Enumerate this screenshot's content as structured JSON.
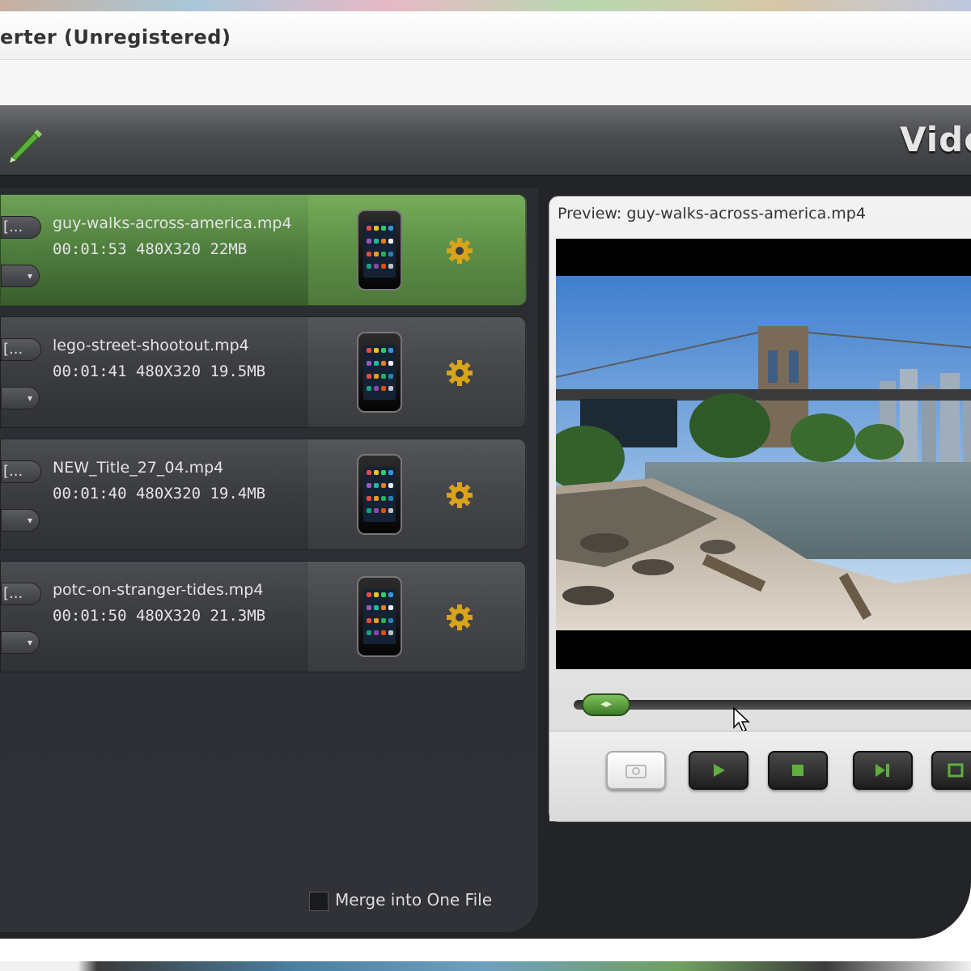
{
  "window": {
    "title": "erter (Unregistered)"
  },
  "toolbar": {
    "title": "Vide",
    "edit_icon": "pencil-icon"
  },
  "files": [
    {
      "name": "guy-walks-across-america.mp4",
      "meta": "00:01:53  480X320  22MB",
      "pill": "[...",
      "selected": true
    },
    {
      "name": "lego-street-shootout.mp4",
      "meta": "00:01:41  480X320  19.5MB",
      "pill": "[...",
      "selected": false
    },
    {
      "name": "NEW_Title_27_04.mp4",
      "meta": "00:01:40  480X320  19.4MB",
      "pill": "[...",
      "selected": false
    },
    {
      "name": "potc-on-stranger-tides.mp4",
      "meta": "00:01:50  480X320  21.3MB",
      "pill": "[...",
      "selected": false
    }
  ],
  "merge": {
    "label": "Merge into One File",
    "checked": false
  },
  "preview": {
    "title": "Preview: guy-walks-across-america.mp4",
    "progress": 0.02
  },
  "controls": [
    {
      "name": "snapshot-button",
      "icon": "camera-icon",
      "disabled": true
    },
    {
      "name": "play-button",
      "icon": "play-icon",
      "disabled": false
    },
    {
      "name": "stop-button",
      "icon": "stop-icon",
      "disabled": false
    },
    {
      "name": "next-button",
      "icon": "next-icon",
      "disabled": false
    },
    {
      "name": "fullscreen-button",
      "icon": "fullscreen-icon",
      "disabled": false
    }
  ],
  "colors": {
    "accent_green": "#5fae3e",
    "gear_gold": "#d9a41a",
    "panel_dark": "#2a2c31"
  }
}
